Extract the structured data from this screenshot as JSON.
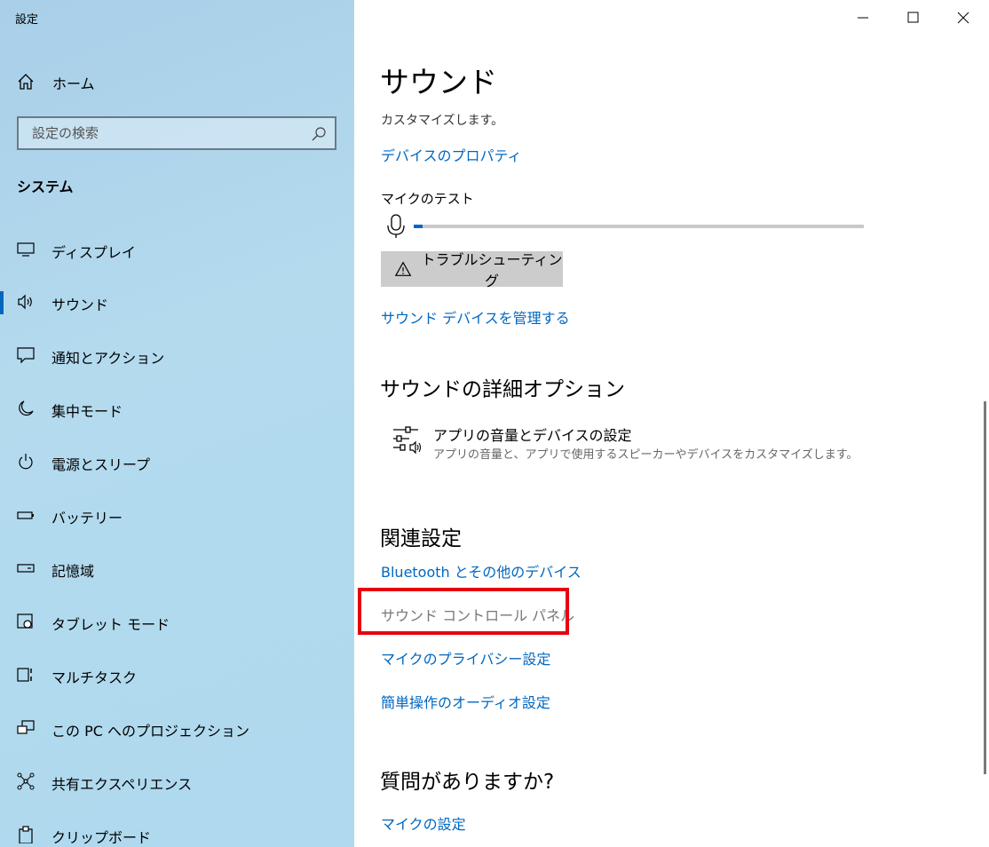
{
  "window": {
    "title": "設定"
  },
  "sidebar": {
    "home_label": "ホーム",
    "search_placeholder": "設定の検索",
    "section": "システム",
    "items": [
      {
        "label": "ディスプレイ",
        "icon": "display-icon"
      },
      {
        "label": "サウンド",
        "icon": "speaker-icon",
        "active": true
      },
      {
        "label": "通知とアクション",
        "icon": "notification-icon"
      },
      {
        "label": "集中モード",
        "icon": "moon-icon"
      },
      {
        "label": "電源とスリープ",
        "icon": "power-icon"
      },
      {
        "label": "バッテリー",
        "icon": "battery-icon"
      },
      {
        "label": "記憶域",
        "icon": "storage-icon"
      },
      {
        "label": "タブレット モード",
        "icon": "tablet-mode-icon"
      },
      {
        "label": "マルチタスク",
        "icon": "multitask-icon"
      },
      {
        "label": "この PC へのプロジェクション",
        "icon": "projection-icon"
      },
      {
        "label": "共有エクスペリエンス",
        "icon": "shared-experience-icon"
      },
      {
        "label": "クリップボード",
        "icon": "clipboard-icon"
      }
    ]
  },
  "main": {
    "title": "サウンド",
    "description": "カスタマイズします。",
    "device_properties_link": "デバイスのプロパティ",
    "mic_test_label": "マイクのテスト",
    "mic_level": 0.01,
    "troubleshoot_button": "トラブルシューティング",
    "manage_devices_link": "サウンド デバイスを管理する",
    "advanced_heading": "サウンドの詳細オプション",
    "app_volume": {
      "title": "アプリの音量とデバイスの設定",
      "subtitle": "アプリの音量と、アプリで使用するスピーカーやデバイスをカスタマイズします。"
    },
    "related_heading": "関連設定",
    "related_links": [
      "Bluetooth とその他のデバイス",
      "サウンド コントロール パネル",
      "マイクのプライバシー設定",
      "簡単操作のオーディオ設定"
    ],
    "question_heading": "質問がありますか?",
    "mic_settings_link": "マイクの設定"
  },
  "colors": {
    "accent": "#0067c0",
    "highlight": "#e60012"
  }
}
